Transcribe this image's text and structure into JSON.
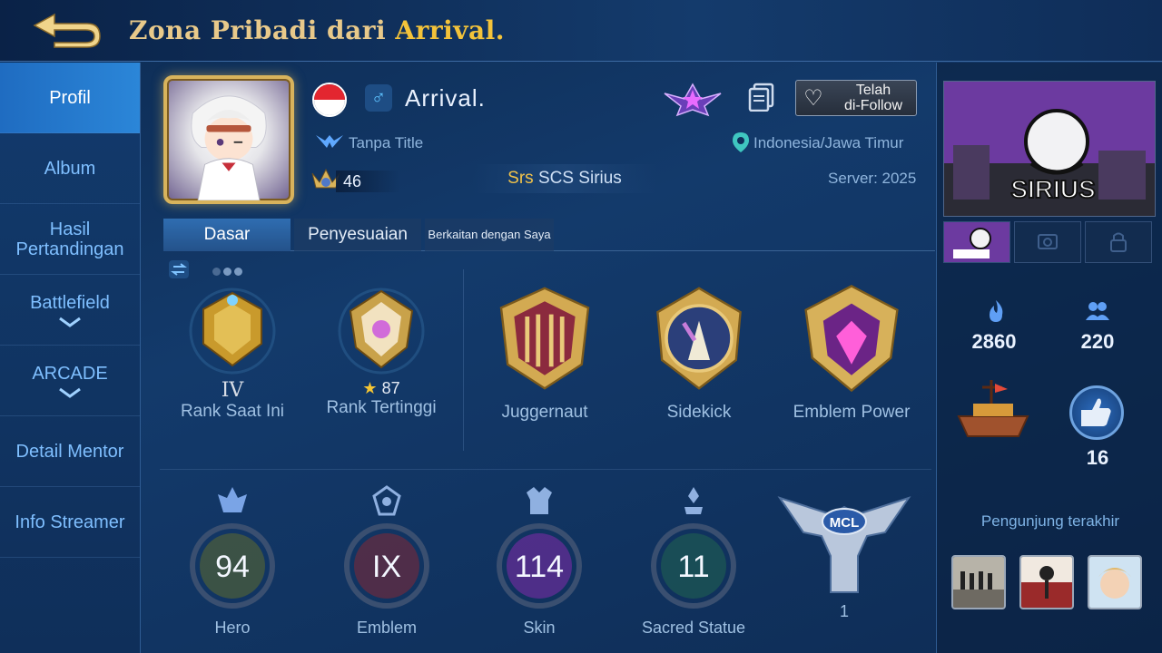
{
  "header": {
    "back_label": "back",
    "title_prefix": "Zona Pribadi dari ",
    "title_user": "Arrival."
  },
  "sidebar": {
    "items": [
      {
        "label": "Profil",
        "active": true
      },
      {
        "label": "Album"
      },
      {
        "label": "Hasil Pertandingan"
      },
      {
        "label": "Battlefield",
        "chevron": "⌵"
      },
      {
        "label": "ARCADE",
        "chevron": "⌵"
      },
      {
        "label": "Detail Mentor"
      },
      {
        "label": "Info Streamer"
      }
    ]
  },
  "profile": {
    "name": "Arrival.",
    "gender_icon": "♂",
    "title": "Tanpa Title",
    "location": "Indonesia/Jawa Timur",
    "level": "46",
    "squad_tag": "Srs",
    "squad_name": " SCS Sirius",
    "server": "Server: 2025",
    "follow_label_line1": "Telah",
    "follow_label_line2": "di-Follow",
    "accent_color": "#f3c33a"
  },
  "tabs": [
    {
      "label": "Dasar",
      "active": true
    },
    {
      "label": "Penyesuaian"
    },
    {
      "label": "Berkaitan dengan Saya"
    }
  ],
  "badges": [
    {
      "label": "Rank Saat Ini",
      "value": "IV"
    },
    {
      "label": "Rank Tertinggi",
      "value": "87"
    },
    {
      "label": "Juggernaut"
    },
    {
      "label": "Sidekick"
    },
    {
      "label": "Emblem Power"
    }
  ],
  "stats": [
    {
      "label": "Hero",
      "value": "94",
      "color": "#b3c84a"
    },
    {
      "label": "Emblem",
      "value": "IX",
      "color": "#d04a5a"
    },
    {
      "label": "Skin",
      "value": "114",
      "color": "#9b4ad8"
    },
    {
      "label": "Sacred Statue",
      "value": "11",
      "color": "#3a9a7a"
    },
    {
      "label": "1",
      "value": "MCL"
    }
  ],
  "right": {
    "popularity": "2860",
    "friends": "220",
    "likes": "16",
    "visitors_label": "Pengunjung terakhir",
    "banner_text": "SIRIUS"
  }
}
